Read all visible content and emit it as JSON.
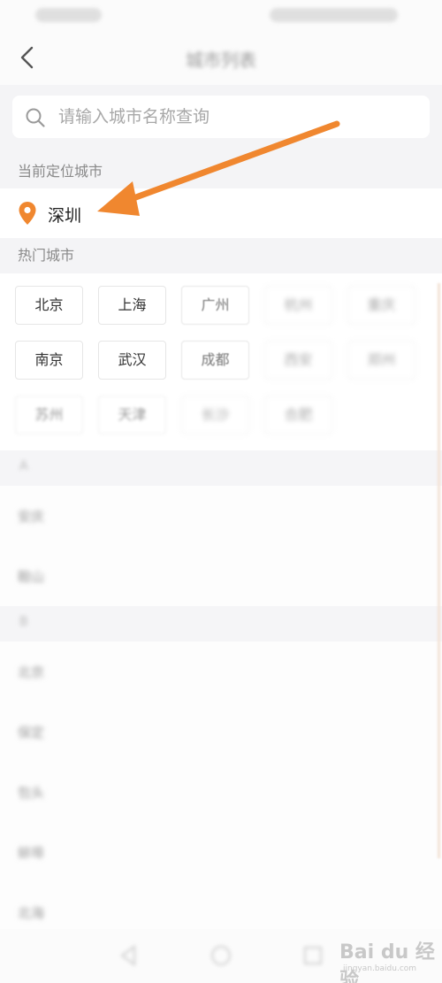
{
  "header": {
    "title": "城市列表"
  },
  "search": {
    "placeholder": "请输入城市名称查询"
  },
  "sections": {
    "current_label": "当前定位城市",
    "hot_label": "热门城市"
  },
  "current_city": "深圳",
  "hot_cities": [
    "北京",
    "上海",
    "广州",
    "杭州",
    "重庆",
    "南京",
    "武汉",
    "成都",
    "西安",
    "郑州",
    "苏州",
    "天津",
    "长沙",
    "合肥"
  ],
  "letters": [
    "A",
    "B"
  ],
  "list_items": [
    "安庆",
    "鞍山",
    "北京",
    "保定",
    "包头",
    "蚌埠",
    "北海"
  ],
  "watermark": {
    "text": "Bai du 经验",
    "sub": "jingyan.baidu.com"
  },
  "colors": {
    "accent": "#f0872f",
    "background": "#f4f4f6"
  }
}
